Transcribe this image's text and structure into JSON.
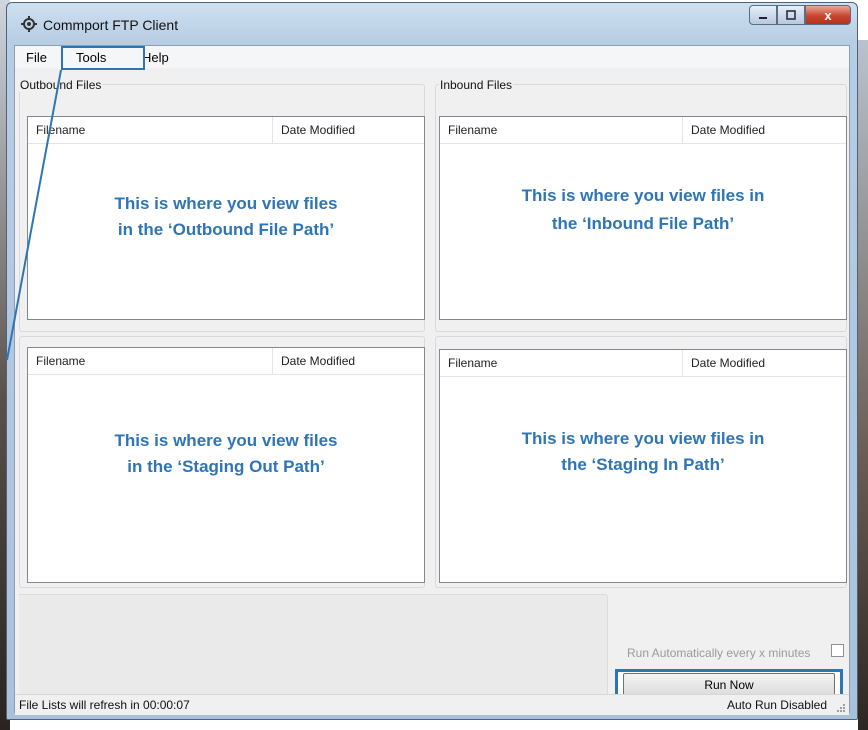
{
  "window": {
    "title": "Commport FTP Client",
    "minimize_icon": "minimize-icon",
    "maximize_icon": "maximize-icon",
    "close_icon": "close-icon",
    "close_glyph": "x"
  },
  "menu": {
    "items": [
      "File",
      "Tools",
      "Help"
    ]
  },
  "groups": {
    "outbound_label": "Outbound Files",
    "inbound_label": "Inbound Files"
  },
  "lists": {
    "outbound": {
      "columns": [
        "Filename",
        "Date Modified"
      ],
      "note_line1": "This is where you view files",
      "note_line2": "in the ‘Outbound File Path’"
    },
    "inbound": {
      "columns": [
        "Filename",
        "Date Modified"
      ],
      "note_line1": "This is where you view files in",
      "note_line2": "the ‘Inbound File Path’"
    },
    "staging_out": {
      "columns": [
        "Filename",
        "Date Modified"
      ],
      "note_line1": "This is where you view files",
      "note_line2": "in the ‘Staging Out Path’"
    },
    "staging_in": {
      "columns": [
        "Filename",
        "Date Modified"
      ],
      "note_line1": "This is where you view files in",
      "note_line2": "the ‘Staging In Path’"
    }
  },
  "controls": {
    "auto_run_label": "Run Automatically every x minutes",
    "auto_run_checked": false,
    "run_now_label": "Run Now"
  },
  "status": {
    "refresh_text": "File Lists will refresh in 00:00:07",
    "auto_run_status": "Auto Run Disabled"
  },
  "colors": {
    "annotation_blue": "#2e75b6",
    "disabled_text": "#9a9a9a"
  }
}
